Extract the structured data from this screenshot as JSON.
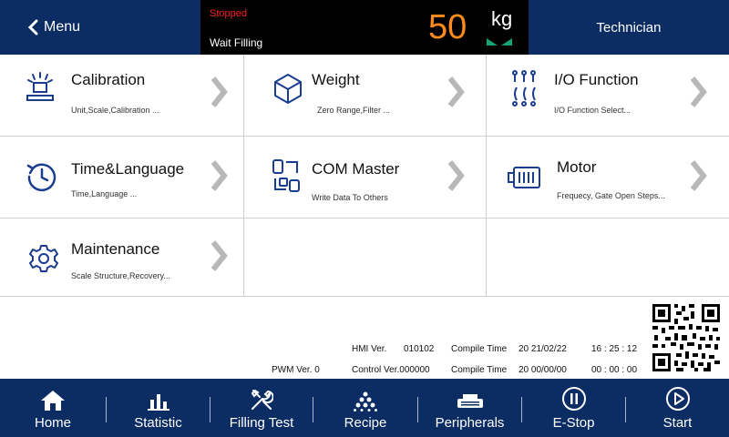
{
  "header": {
    "menu_label": "Menu",
    "status_state": "Stopped",
    "status_mode": "Wait Filling",
    "weight_value": "50",
    "weight_unit": "kg",
    "user_role": "Technician"
  },
  "menu_items": [
    {
      "title": "Calibration",
      "subtitle": "Unit,Scale,Calibration ...",
      "icon": "calibration-icon"
    },
    {
      "title": "Weight",
      "subtitle": "Zero Range,Filter ...",
      "icon": "cube-icon"
    },
    {
      "title": "I/O Function",
      "subtitle": "I/O Function Select...",
      "icon": "io-icon"
    },
    {
      "title": "Time&Language",
      "subtitle": "Time,Language ...",
      "icon": "clock-icon"
    },
    {
      "title": "COM Master",
      "subtitle": "Write Data To Others",
      "icon": "com-icon"
    },
    {
      "title": "Motor",
      "subtitle": "Frequecy, Gate Open Steps...",
      "icon": "motor-icon"
    },
    {
      "title": "Maintenance",
      "subtitle": "Scale Structure,Recovery...",
      "icon": "gear-icon"
    }
  ],
  "version_info": {
    "hmi_label": "HMI Ver.",
    "hmi_value": "010102",
    "compile_label_1": "Compile Time",
    "compile_date_1": "20 21/02/22",
    "compile_time_1": "16 : 25 : 12",
    "pwm_label": "PWM Ver. 0",
    "control_label": "Control Ver.000000",
    "compile_label_2": "Compile Time",
    "compile_date_2": "20 00/00/00",
    "compile_time_2": "00 : 00 : 00"
  },
  "nav": [
    {
      "label": "Home",
      "icon": "home-icon"
    },
    {
      "label": "Statistic",
      "icon": "bar-chart-icon"
    },
    {
      "label": "Filling Test",
      "icon": "tools-icon"
    },
    {
      "label": "Recipe",
      "icon": "recipe-icon"
    },
    {
      "label": "Peripherals",
      "icon": "printer-icon"
    },
    {
      "label": "E-Stop",
      "icon": "pause-circle-icon"
    },
    {
      "label": "Start",
      "icon": "play-circle-icon"
    }
  ],
  "colors": {
    "header_bg": "#0c2c64",
    "weight_color": "#ff8c1a",
    "stopped_color": "#ff2020",
    "icon_blue": "#1a3d8f",
    "stable_green": "#17a37a"
  }
}
